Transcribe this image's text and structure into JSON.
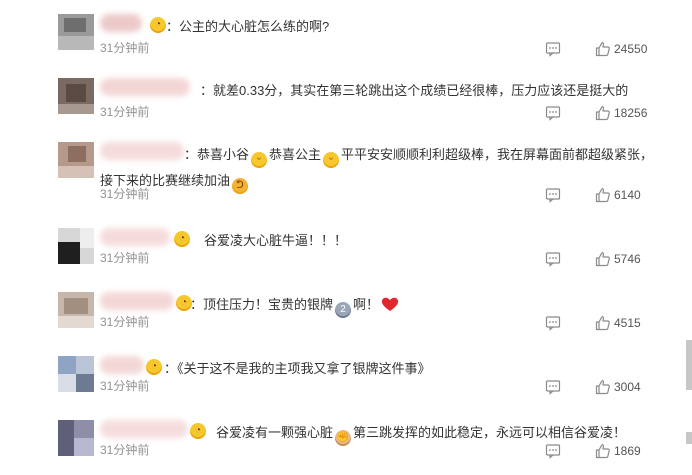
{
  "comments": [
    {
      "time": "31分钟前",
      "likes": "24550",
      "segments": [
        {
          "t": "：公主的大心脏怎么练的啊?"
        }
      ]
    },
    {
      "time": "31分钟前",
      "likes": "18256",
      "segments": [
        {
          "t": "：就差0.33分，其实在第三轮跳出这个成绩已经很棒，压力应该还是挺大的"
        }
      ]
    },
    {
      "time": "31分钟前",
      "likes": "6140",
      "segments": [
        {
          "t": "：恭喜小谷"
        },
        {
          "emoji": "laugh"
        },
        {
          "t": "恭喜公主"
        },
        {
          "emoji": "laugh"
        },
        {
          "t": "平平安安顺顺利利超级棒，我在屏幕面前都超级紧张，接下来的比赛继续加油"
        },
        {
          "emoji": "muscle"
        }
      ]
    },
    {
      "time": "31分钟前",
      "likes": "5746",
      "segments": [
        {
          "t": "谷爱凌大心脏牛逼！！！"
        }
      ]
    },
    {
      "time": "31分钟前",
      "likes": "4515",
      "segments": [
        {
          "t": "：顶住压力！宝贵的银牌"
        },
        {
          "emoji": "medal"
        },
        {
          "t": "啊！"
        },
        {
          "emoji": "heart"
        }
      ]
    },
    {
      "time": "31分钟前",
      "likes": "3004",
      "segments": [
        {
          "t": "：《关于这不是我的主项我又拿了银牌这件事》"
        }
      ]
    },
    {
      "time": "31分钟前",
      "likes": "1869",
      "segments": [
        {
          "t": "谷爱凌有一颗强心脏"
        },
        {
          "emoji": "fist"
        },
        {
          "t": "第三跳发挥的如此稳定，永远可以相信谷爱凌！"
        }
      ]
    }
  ],
  "icons": {
    "reply": "comment-icon",
    "like": "thumbs-up-icon",
    "emoji_color": "#f7c72e",
    "heart_color": "#e0282e"
  }
}
